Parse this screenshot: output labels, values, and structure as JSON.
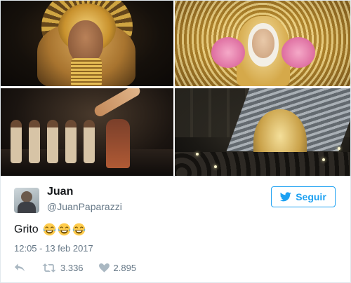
{
  "tweet": {
    "author": {
      "name": "Juan",
      "handle": "@JuanPaparazzi"
    },
    "follow_label": "Seguir",
    "text": "Grito",
    "emojis": [
      "joy-emoji",
      "joy-emoji",
      "joy-emoji"
    ],
    "timestamp": "12:05 - 13 feb 2017",
    "actions": {
      "retweets": "3.336",
      "likes": "2.895"
    }
  },
  "media": [
    {
      "icon": "photo-golden-headdress-portrait"
    },
    {
      "icon": "photo-golden-virgin-statue"
    },
    {
      "icon": "photo-stage-performance"
    },
    {
      "icon": "photo-night-procession"
    }
  ],
  "colors": {
    "accent": "#1da1f2",
    "text_primary": "#14171a",
    "text_secondary": "#657786",
    "icon_muted": "#aab8c2",
    "border": "#e1e8ed"
  }
}
